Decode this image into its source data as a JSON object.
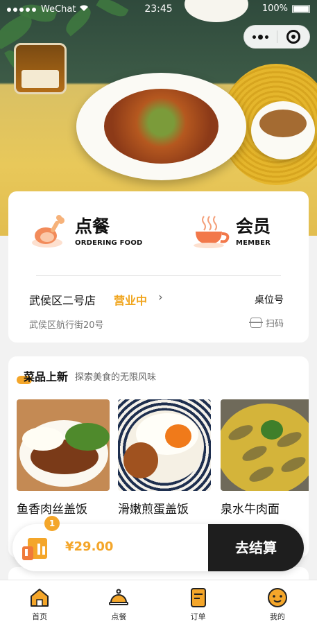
{
  "status_bar": {
    "carrier": "WeChat",
    "time": "23:45",
    "battery": "100%"
  },
  "ordering": {
    "title": "点餐",
    "subtitle": "ORDERING FOOD"
  },
  "member": {
    "title": "会员",
    "subtitle": "MEMBER"
  },
  "store": {
    "name": "武侯区二号店",
    "status": "营业中",
    "address": "武侯区航行街20号",
    "table_label": "桌位号",
    "scan_label": "扫码"
  },
  "new_dishes": {
    "title": "菜品上新",
    "subtitle": "探索美食的无限风味",
    "items": [
      {
        "name": "鱼香肉丝盖饭"
      },
      {
        "name": "滑嫩煎蛋盖饭"
      },
      {
        "name": "泉水牛肉面"
      }
    ]
  },
  "cart": {
    "count": "1",
    "price": "¥29.00",
    "checkout_label": "去结算"
  },
  "tabbar": [
    {
      "label": "首页",
      "icon": "home-icon",
      "active": true
    },
    {
      "label": "点餐",
      "icon": "cloche-icon",
      "active": false
    },
    {
      "label": "订单",
      "icon": "order-icon",
      "active": false
    },
    {
      "label": "我的",
      "icon": "profile-icon",
      "active": false
    }
  ],
  "colors": {
    "accent": "#f4a62a",
    "dark": "#1e1e1e"
  }
}
